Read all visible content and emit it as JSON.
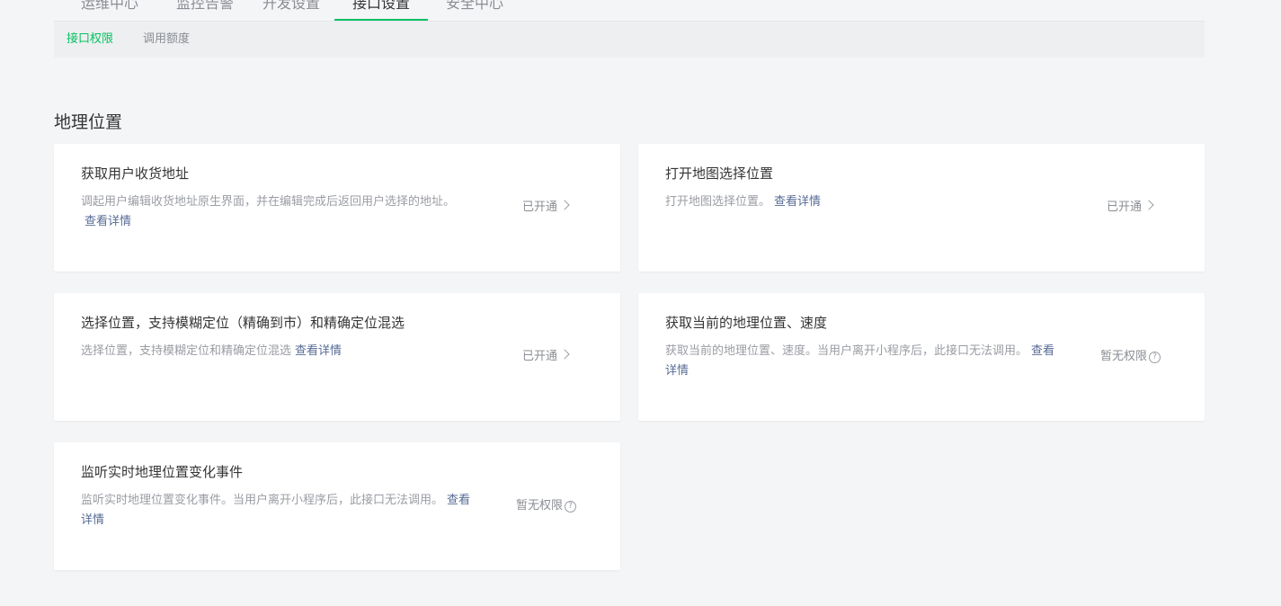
{
  "topnav": {
    "tabs": [
      {
        "label": "运维中心"
      },
      {
        "label": "监控告警"
      },
      {
        "label": "开发设置"
      },
      {
        "label": "接口设置"
      },
      {
        "label": "安全中心"
      }
    ]
  },
  "subnav": {
    "items": [
      {
        "label": "接口权限"
      },
      {
        "label": "调用额度"
      }
    ]
  },
  "section": {
    "title": "地理位置"
  },
  "cards": [
    {
      "title": "获取用户收货地址",
      "desc": "调起用户编辑收货地址原生界面，并在编辑完成后返回用户选择的地址。",
      "detail": "查看详情",
      "status": "已开通"
    },
    {
      "title": "打开地图选择位置",
      "desc": "打开地图选择位置。",
      "detail": "查看详情",
      "status": "已开通"
    },
    {
      "title": "选择位置，支持模糊定位（精确到市）和精确定位混选",
      "desc": "选择位置，支持模糊定位和精确定位混选",
      "detail": "查看详情",
      "status": "已开通"
    },
    {
      "title": "获取当前的地理位置、速度",
      "desc": "获取当前的地理位置、速度。当用户离开小程序后，此接口无法调用。",
      "detail": "查看详情",
      "status": "暂无权限"
    },
    {
      "title": "监听实时地理位置变化事件",
      "desc": "监听实时地理位置变化事件。当用户离开小程序后，此接口无法调用。",
      "detail": "查看详情",
      "status": "暂无权限"
    }
  ]
}
